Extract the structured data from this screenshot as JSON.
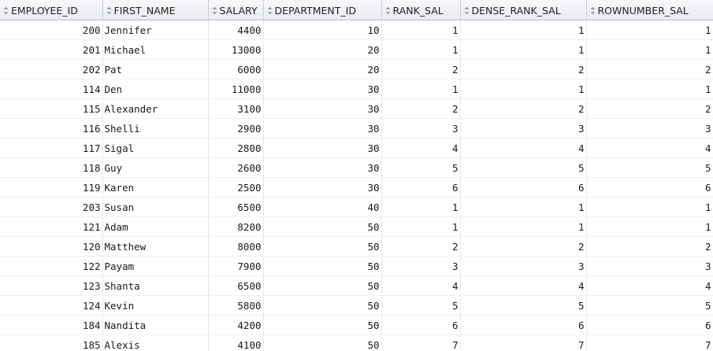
{
  "grid": {
    "columns": [
      {
        "label": "EMPLOYEE_ID",
        "align": "right"
      },
      {
        "label": "FIRST_NAME",
        "align": "left"
      },
      {
        "label": "SALARY",
        "align": "right"
      },
      {
        "label": "DEPARTMENT_ID",
        "align": "right"
      },
      {
        "label": "RANK_SAL",
        "align": "right"
      },
      {
        "label": "DENSE_RANK_SAL",
        "align": "right"
      },
      {
        "label": "ROWNUMBER_SAL",
        "align": "right"
      }
    ],
    "rows": [
      [
        "200",
        "Jennifer",
        "4400",
        "10",
        "1",
        "1",
        "1"
      ],
      [
        "201",
        "Michael",
        "13000",
        "20",
        "1",
        "1",
        "1"
      ],
      [
        "202",
        "Pat",
        "6000",
        "20",
        "2",
        "2",
        "2"
      ],
      [
        "114",
        "Den",
        "11000",
        "30",
        "1",
        "1",
        "1"
      ],
      [
        "115",
        "Alexander",
        "3100",
        "30",
        "2",
        "2",
        "2"
      ],
      [
        "116",
        "Shelli",
        "2900",
        "30",
        "3",
        "3",
        "3"
      ],
      [
        "117",
        "Sigal",
        "2800",
        "30",
        "4",
        "4",
        "4"
      ],
      [
        "118",
        "Guy",
        "2600",
        "30",
        "5",
        "5",
        "5"
      ],
      [
        "119",
        "Karen",
        "2500",
        "30",
        "6",
        "6",
        "6"
      ],
      [
        "203",
        "Susan",
        "6500",
        "40",
        "1",
        "1",
        "1"
      ],
      [
        "121",
        "Adam",
        "8200",
        "50",
        "1",
        "1",
        "1"
      ],
      [
        "120",
        "Matthew",
        "8000",
        "50",
        "2",
        "2",
        "2"
      ],
      [
        "122",
        "Payam",
        "7900",
        "50",
        "3",
        "3",
        "3"
      ],
      [
        "123",
        "Shanta",
        "6500",
        "50",
        "4",
        "4",
        "4"
      ],
      [
        "124",
        "Kevin",
        "5800",
        "50",
        "5",
        "5",
        "5"
      ],
      [
        "184",
        "Nandita",
        "4200",
        "50",
        "6",
        "6",
        "6"
      ],
      [
        "185",
        "Alexis",
        "4100",
        "50",
        "7",
        "7",
        "7"
      ]
    ]
  },
  "icons": {
    "column_header": "sort-icon"
  },
  "colors": {
    "header_bg": "#eceff2",
    "header_border": "#c6cbd1",
    "grid_line": "#e7e9ec",
    "text": "#1a1a1a"
  }
}
